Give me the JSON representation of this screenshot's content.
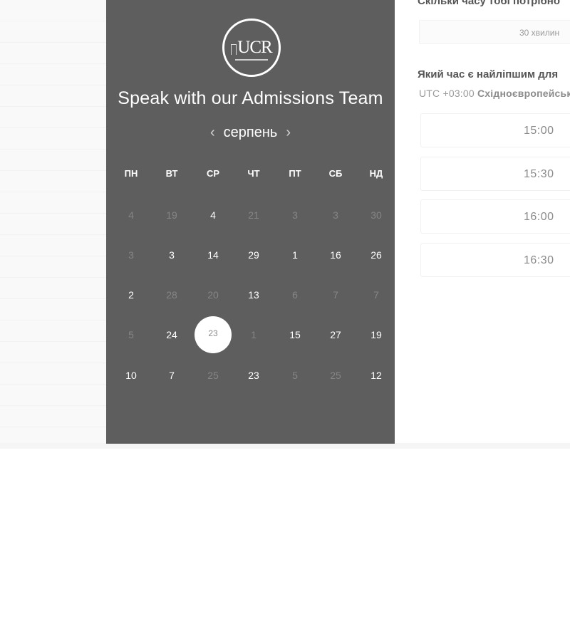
{
  "calendar": {
    "logo_text": "UCR",
    "title": "Speak with our Admissions Team",
    "month": "серпень",
    "prev_icon": "‹",
    "next_icon": "›",
    "weekdays": [
      "ПН",
      "ВТ",
      "СР",
      "ЧТ",
      "ПТ",
      "СБ",
      "НД"
    ],
    "weeks": [
      [
        {
          "d": "4",
          "muted": true
        },
        {
          "d": "19",
          "muted": true
        },
        {
          "d": "4",
          "muted": false
        },
        {
          "d": "21",
          "muted": true
        },
        {
          "d": "3",
          "muted": true
        },
        {
          "d": "3",
          "muted": true
        },
        {
          "d": "30",
          "muted": true
        }
      ],
      [
        {
          "d": "3",
          "muted": true
        },
        {
          "d": "3",
          "muted": false
        },
        {
          "d": "14",
          "muted": false
        },
        {
          "d": "29",
          "muted": false
        },
        {
          "d": "1",
          "muted": false
        },
        {
          "d": "16",
          "muted": false
        },
        {
          "d": "26",
          "muted": false
        }
      ],
      [
        {
          "d": "2",
          "muted": false
        },
        {
          "d": "28",
          "muted": true
        },
        {
          "d": "20",
          "muted": true
        },
        {
          "d": "13",
          "muted": false
        },
        {
          "d": "6",
          "muted": true
        },
        {
          "d": "7",
          "muted": true
        },
        {
          "d": "7",
          "muted": true
        }
      ],
      [
        {
          "d": "5",
          "muted": true
        },
        {
          "d": "24",
          "muted": false
        },
        {
          "d": "23",
          "muted": false,
          "selected": true
        },
        {
          "d": "1",
          "muted": true
        },
        {
          "d": "15",
          "muted": false
        },
        {
          "d": "27",
          "muted": false
        },
        {
          "d": "19",
          "muted": false
        }
      ],
      [
        {
          "d": "10",
          "muted": false
        },
        {
          "d": "7",
          "muted": false
        },
        {
          "d": "25",
          "muted": true
        },
        {
          "d": "23",
          "muted": false
        },
        {
          "d": "5",
          "muted": true
        },
        {
          "d": "25",
          "muted": true
        },
        {
          "d": "12",
          "muted": false
        }
      ]
    ]
  },
  "booking": {
    "duration_question": "Скільки часу тобі потрібно",
    "duration_value": "30 хвилин",
    "time_question": "Який час є найліпшим для",
    "tz_offset": "UTC +03:00",
    "tz_name": "Східноєвропейськ",
    "slots": [
      "15:00",
      "15:30",
      "16:00",
      "16:30"
    ]
  },
  "colors": {
    "panel_bg": "#5e5e5e",
    "selected_bg": "#ffffff",
    "muted_day": "#858585"
  }
}
